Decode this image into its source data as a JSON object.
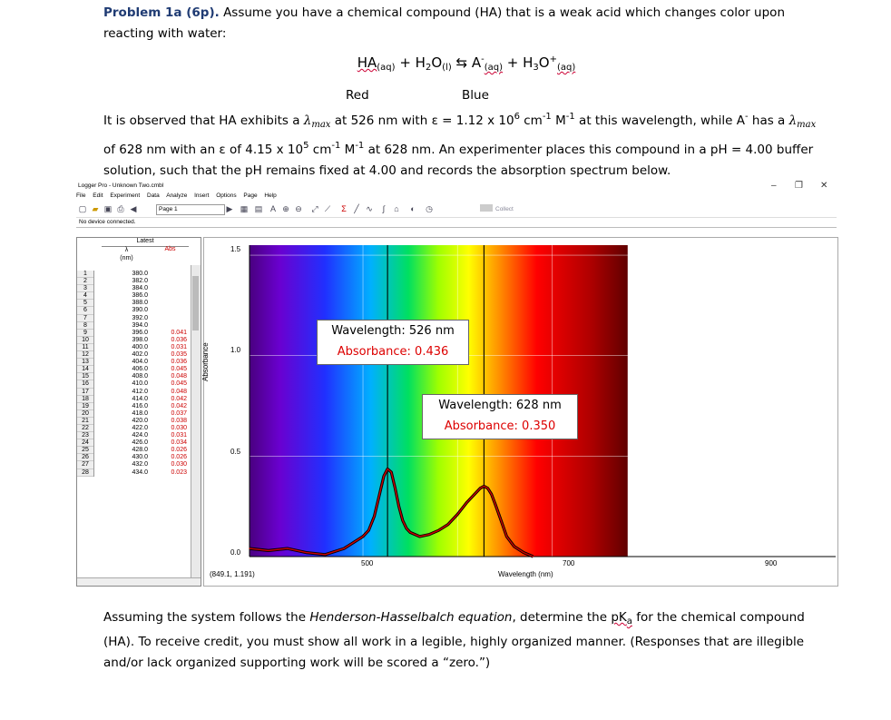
{
  "problem": {
    "title": "Problem 1a (6p).",
    "intro_text": " Assume you have a chemical compound (HA) that is a weak acid which changes color upon reacting with water:",
    "equation": {
      "ha": "HA",
      "ha_sub": "(aq)",
      "plus1": " + H",
      "h2o_sub2": "2",
      "o": "O",
      "h2o_sub": "(l)",
      "arrow": "⇆",
      "a": " A",
      "a_sup": "-",
      "a_sub": "(aq)",
      "plus2": " + H",
      "h3_sub": "3",
      "o2": "O",
      "h3o_sup": "+",
      "h3o_sub": "(aq)"
    },
    "color_red": "Red",
    "color_blue": "Blue",
    "para1_a": "It is observed that HA exhibits a ",
    "lambda_max": "λ",
    "lambda_sub": "max",
    "para1_b": " at 526 nm with ε = 1.12 x 10",
    "exp1": "6",
    "para1_c": " cm",
    "exp_m1": "-1",
    "para1_d": " M",
    "para1_e": " at this wavelength, while A",
    "a_minus": "-",
    "para1_f": " has a ",
    "para1_g": " of 628 nm with an ε of 4.15 x 10",
    "exp2": "5",
    "para1_h": " at 628 nm. An experimenter places this compound in a pH = 4.00 buffer solution, such that the pH remains fixed at 4.00 and records the absorption spectrum below.",
    "para2_a": "Assuming the system follows the ",
    "para2_italic": "Henderson-Hasselbalch equation",
    "para2_b": ", determine the ",
    "pka_p": "pK",
    "pka_sub": "a",
    "para2_c": " for the chemical compound (HA). To receive credit, you must show all work in a legible, highly organized manner. (Responses that are illegible and/or lack organized supporting work will be scored a “zero.”)"
  },
  "window": {
    "title": "Logger Pro - Unknown Two.cmbl",
    "controls": {
      "minimize": "–",
      "restore": "❐",
      "close": "✕"
    },
    "menu": [
      "File",
      "Edit",
      "Experiment",
      "Data",
      "Analyze",
      "Insert",
      "Options",
      "Page",
      "Help"
    ],
    "page_select": "Page 1",
    "collect": "Collect",
    "status": "No device connected."
  },
  "table": {
    "header_group": "Latest",
    "col_x_label": "λ",
    "col_x_unit": "(nm)",
    "col_y_label": "Abs",
    "rows": [
      [
        "1",
        "380.0",
        ""
      ],
      [
        "2",
        "382.0",
        ""
      ],
      [
        "3",
        "384.0",
        ""
      ],
      [
        "4",
        "386.0",
        ""
      ],
      [
        "5",
        "388.0",
        ""
      ],
      [
        "6",
        "390.0",
        ""
      ],
      [
        "7",
        "392.0",
        ""
      ],
      [
        "8",
        "394.0",
        ""
      ],
      [
        "9",
        "396.0",
        "0.041"
      ],
      [
        "10",
        "398.0",
        "0.036"
      ],
      [
        "11",
        "400.0",
        "0.031"
      ],
      [
        "12",
        "402.0",
        "0.035"
      ],
      [
        "13",
        "404.0",
        "0.036"
      ],
      [
        "14",
        "406.0",
        "0.045"
      ],
      [
        "15",
        "408.0",
        "0.048"
      ],
      [
        "16",
        "410.0",
        "0.045"
      ],
      [
        "17",
        "412.0",
        "0.048"
      ],
      [
        "18",
        "414.0",
        "0.042"
      ],
      [
        "19",
        "416.0",
        "0.042"
      ],
      [
        "20",
        "418.0",
        "0.037"
      ],
      [
        "21",
        "420.0",
        "0.038"
      ],
      [
        "22",
        "422.0",
        "0.030"
      ],
      [
        "23",
        "424.0",
        "0.031"
      ],
      [
        "24",
        "426.0",
        "0.034"
      ],
      [
        "25",
        "428.0",
        "0.026"
      ],
      [
        "26",
        "430.0",
        "0.026"
      ],
      [
        "27",
        "432.0",
        "0.030"
      ],
      [
        "28",
        "434.0",
        "0.023"
      ]
    ]
  },
  "graph": {
    "y_title": "Absorbance",
    "x_title": "Wavelength (nm)",
    "coord_readout": "(849.1, 1.191)",
    "y_ticks": [
      "1.5",
      "1.0",
      "0.5",
      "0.0"
    ],
    "x_ticks": [
      "500",
      "700",
      "900"
    ],
    "box1_line1": "Wavelength: 526 nm",
    "box1_line2": "Absorbance: 0.436",
    "box2_line1": "Wavelength: 628 nm",
    "box2_line2": "Absorbance: 0.350"
  },
  "chart_data": {
    "type": "line",
    "xlabel": "Wavelength (nm)",
    "ylabel": "Absorbance",
    "xlim": [
      380,
      1000
    ],
    "ylim": [
      0,
      1.55
    ],
    "markers": [
      {
        "x": 526,
        "y": 0.436
      },
      {
        "x": 628,
        "y": 0.35
      }
    ],
    "series": [
      {
        "x": [
          380,
          400,
          420,
          440,
          460,
          480,
          490,
          500,
          506,
          512,
          518,
          522,
          526,
          530,
          534,
          538,
          542,
          546,
          550,
          560,
          570,
          580,
          590,
          600,
          610,
          618,
          624,
          628,
          632,
          636,
          640,
          646,
          652,
          660,
          670,
          680
        ],
        "y": [
          0.04,
          0.03,
          0.04,
          0.02,
          0.01,
          0.04,
          0.07,
          0.1,
          0.13,
          0.2,
          0.32,
          0.4,
          0.436,
          0.42,
          0.34,
          0.25,
          0.18,
          0.14,
          0.12,
          0.1,
          0.11,
          0.13,
          0.16,
          0.21,
          0.27,
          0.31,
          0.34,
          0.35,
          0.34,
          0.31,
          0.26,
          0.18,
          0.1,
          0.05,
          0.02,
          0.0
        ]
      }
    ],
    "colors": {
      "trace_outer": "#000000",
      "trace_inner": "#cc0000"
    }
  }
}
